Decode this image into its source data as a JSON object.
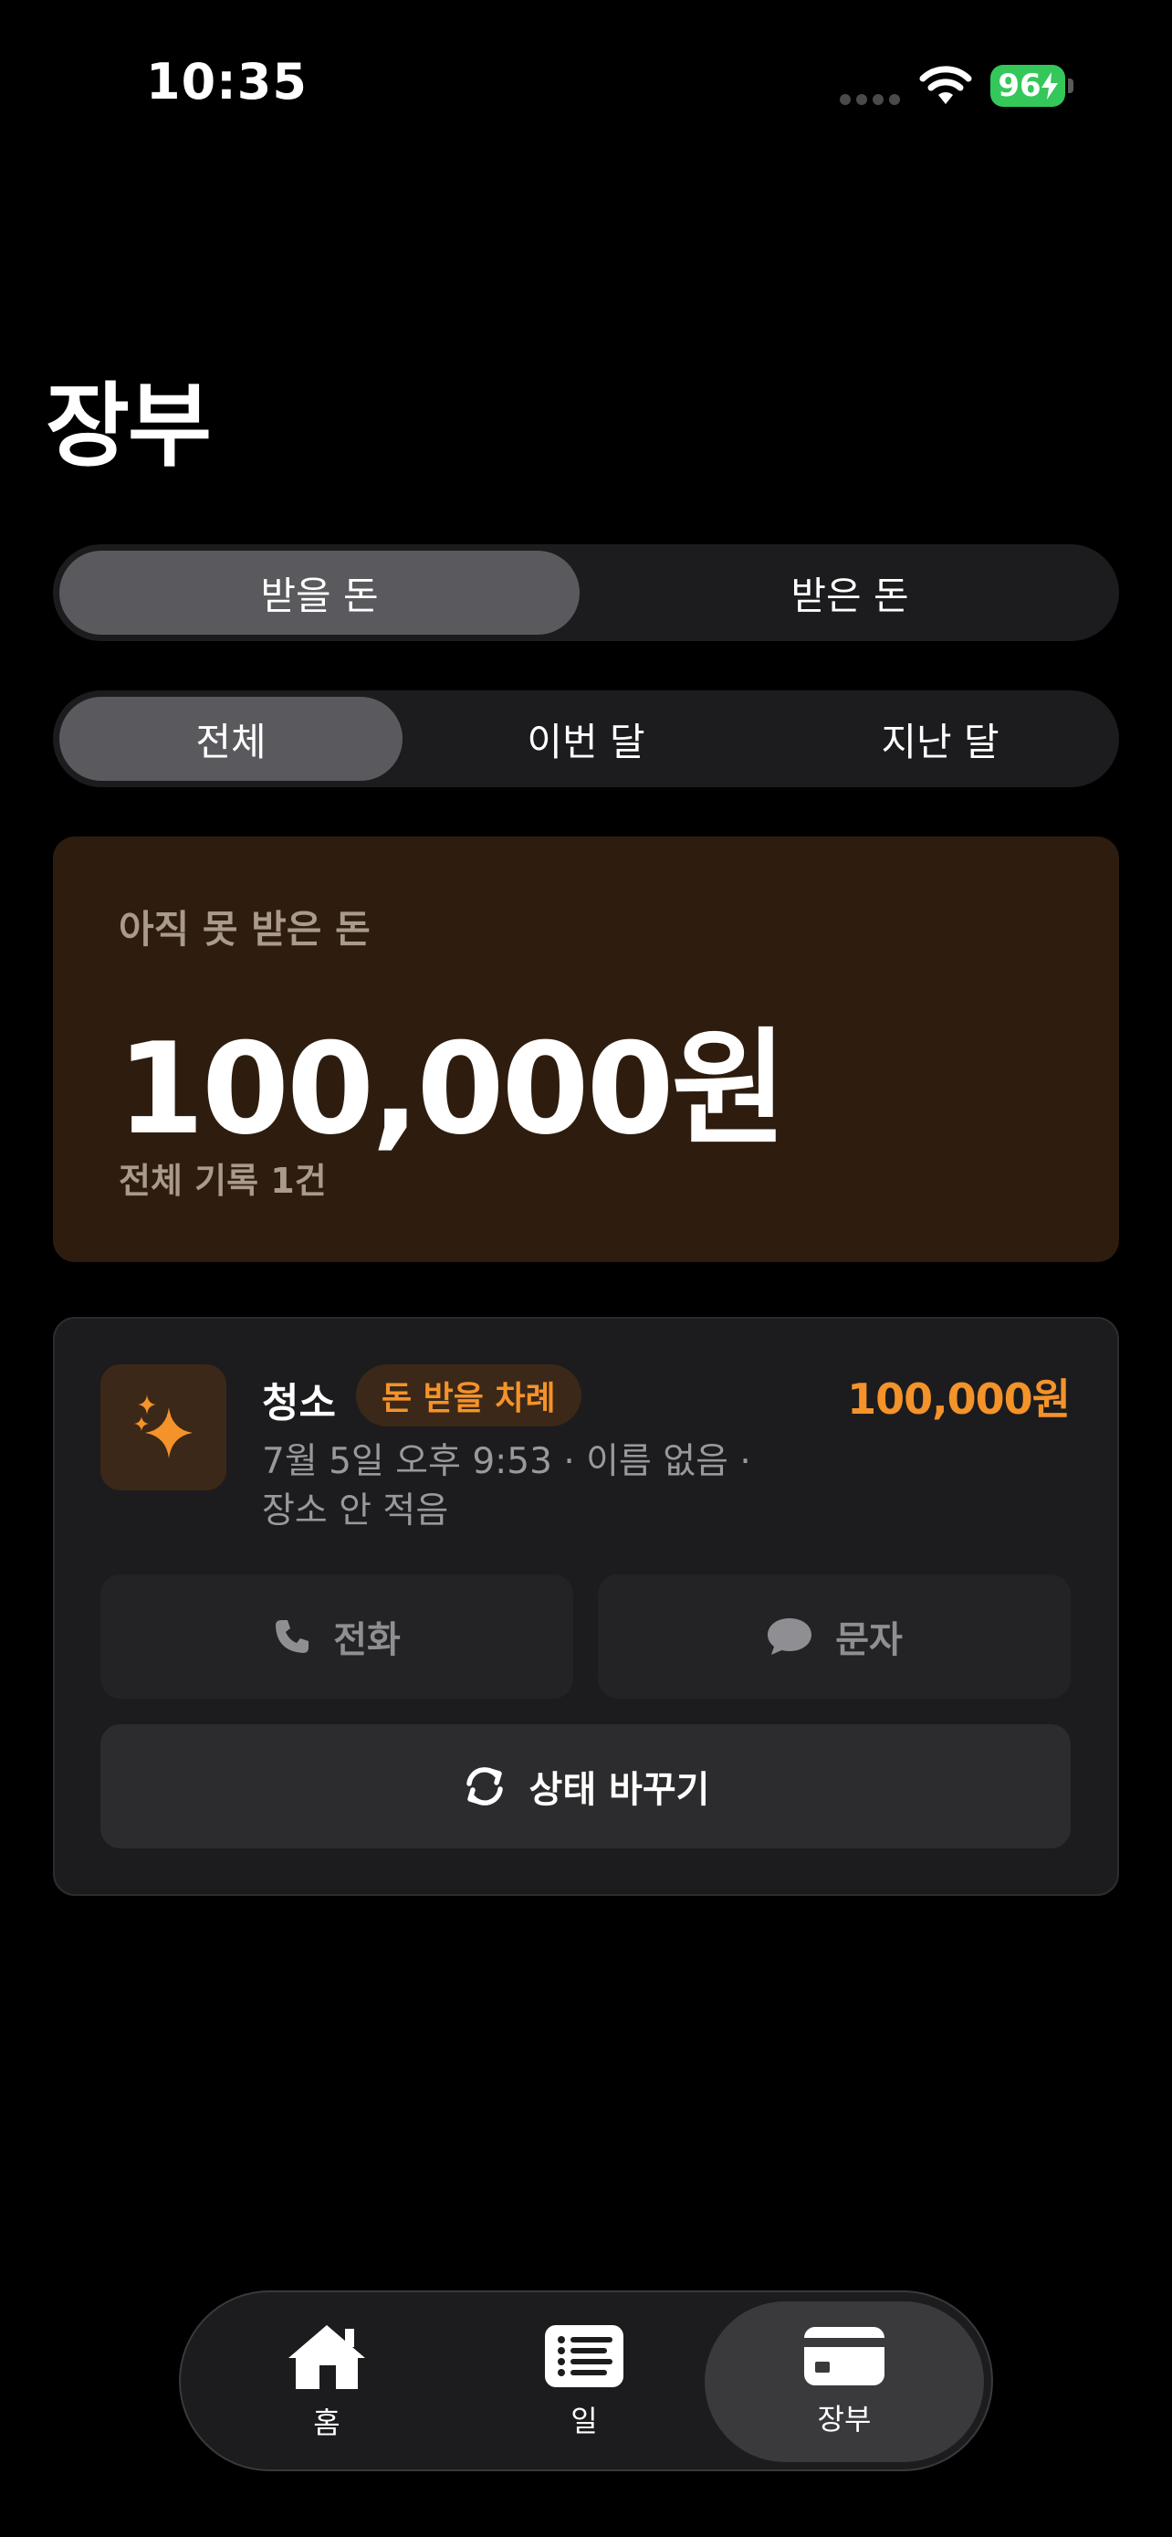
{
  "status_bar": {
    "time": "10:35",
    "battery": "96"
  },
  "page_title": "장부",
  "type_segment": {
    "options": [
      "받을 돈",
      "받은 돈"
    ],
    "selected": 0
  },
  "period_segment": {
    "options": [
      "전체",
      "이번 달",
      "지난 달"
    ],
    "selected": 0
  },
  "summary": {
    "label": "아직 못 받은 돈",
    "amount": "100,000원",
    "count": "전체 기록 1건"
  },
  "record": {
    "icon": "sparkles-icon",
    "title": "청소",
    "badge": "돈 받을 차례",
    "amount": "100,000원",
    "meta_line1": "7월 5일 오후 9:53 · 이름 없음 ·",
    "meta_line2": "장소 안 적음",
    "call_label": "전화",
    "message_label": "문자",
    "change_status_label": "상태 바꾸기"
  },
  "tab_bar": {
    "items": [
      {
        "label": "홈",
        "icon": "house-icon"
      },
      {
        "label": "일",
        "icon": "list-icon"
      },
      {
        "label": "장부",
        "icon": "card-icon"
      }
    ],
    "selected": 2
  },
  "colors": {
    "accent": "#f4932a",
    "summary_bg": "#2e1d0e",
    "battery": "#34c759"
  }
}
